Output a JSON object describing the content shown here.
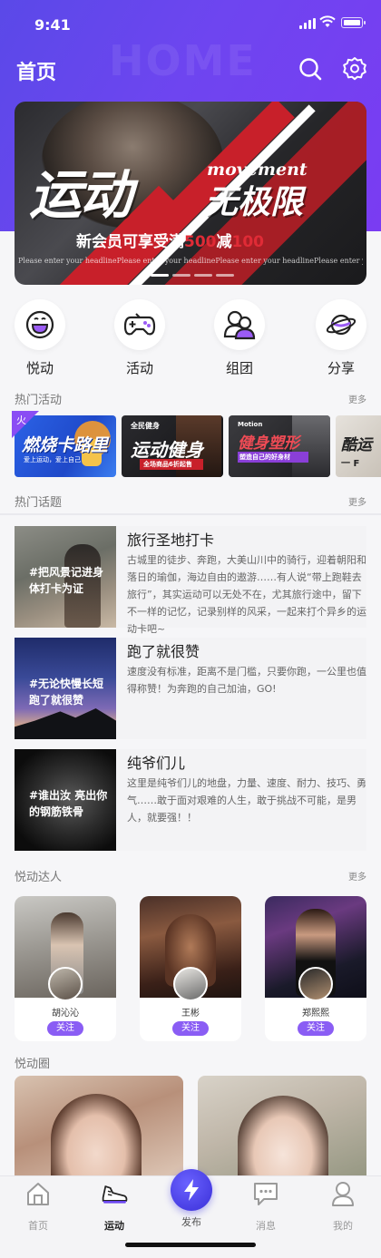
{
  "status": {
    "time": "9:41"
  },
  "header": {
    "title": "首页",
    "watermark": "HOME"
  },
  "banner": {
    "title_big": "运动",
    "title_big2": "无极限",
    "title_en": "movement",
    "subtitle_prefix": "新会员可享受满",
    "subtitle_amount1": "500",
    "subtitle_mid": "减",
    "subtitle_amount2": "100",
    "fine_print": "Please enter your headlinePlease enter your headlinePlease enter your headlinePlease enter your headlinePlease enter your headline Please enter your headlinePlease enter your headlinePlease enter your headlinePlease enter your headlinePlease enter your headline Please enter your headlinePlease enter your headlinePlease enter your headlinePlease enter your headlinePlease enter your headline"
  },
  "quick_nav": [
    {
      "label": "悦动",
      "icon": "smile-icon"
    },
    {
      "label": "活动",
      "icon": "gamepad-icon"
    },
    {
      "label": "组团",
      "icon": "group-icon"
    },
    {
      "label": "分享",
      "icon": "planet-icon"
    }
  ],
  "hot_activities": {
    "title": "热门活动",
    "more": "更多",
    "badge": "火",
    "items": [
      {
        "text": "燃烧卡路里",
        "sub": "爱上运动，爱上自己"
      },
      {
        "text": "运动健身",
        "top": "全民健身",
        "sub": "全场商品6折起售"
      },
      {
        "text": "健身塑形",
        "top": "Motion",
        "sub": "塑造自己的好身材"
      },
      {
        "text": "酷运",
        "sub": "一 F"
      }
    ]
  },
  "hot_topics": {
    "title": "热门话题",
    "more": "更多",
    "items": [
      {
        "thumb_text": "#把风景记进身体打卡为证",
        "title": "旅行圣地打卡",
        "desc": "古城里的徒步、奔跑，大美山川中的骑行，迎着朝阳和落日的瑜伽，海边自由的遨游……有人说“带上跑鞋去旅行”，其实运动可以无处不在，尤其旅行途中，留下不一样的记忆，记录别样的风采，一起来打个异乡的运动卡吧~"
      },
      {
        "thumb_text": "#无论快慢长短跑了就很赞",
        "title": "跑了就很赞",
        "desc": "速度没有标准，距离不是门槛，只要你跑，一公里也值得称赞！为奔跑的自己加油，GO!"
      },
      {
        "thumb_text": "#谁出汝 亮出你的钢筋铁骨",
        "title": "纯爷们儿",
        "desc": "这里是纯爷们儿的地盘，力量、速度、耐力、技巧、勇气……敢于面对艰难的人生，敢于挑战不可能，是男人，就要强！！"
      }
    ]
  },
  "experts": {
    "title": "悦动达人",
    "more": "更多",
    "follow_label": "关注",
    "items": [
      {
        "name": "胡沁沁"
      },
      {
        "name": "王彬"
      },
      {
        "name": "郑熙熙"
      }
    ]
  },
  "circle": {
    "title": "悦动圈"
  },
  "tabbar": [
    {
      "label": "首页",
      "icon": "home-icon",
      "active": false
    },
    {
      "label": "运动",
      "icon": "sneaker-icon",
      "active": true
    },
    {
      "label": "发布",
      "icon": "lightning-icon",
      "active": false
    },
    {
      "label": "消息",
      "icon": "message-icon",
      "active": false
    },
    {
      "label": "我的",
      "icon": "profile-icon",
      "active": false
    }
  ],
  "colors": {
    "accent": "#6a45f0",
    "follow": "#8a5df4",
    "banner_red": "#c8202a"
  }
}
